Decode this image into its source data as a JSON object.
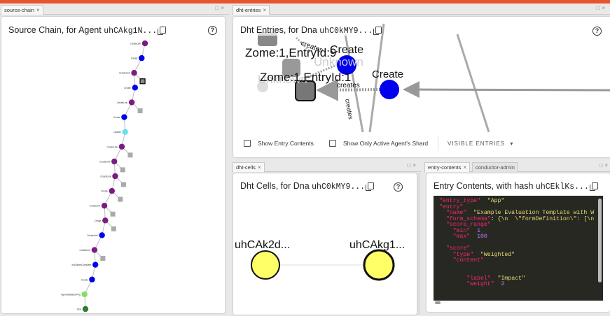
{
  "panels": {
    "source_chain": {
      "tab": "source-chain",
      "title_prefix": "Source Chain",
      "title_middle": ", for Agent ",
      "agent_hash": "uhCAkg1N...",
      "nodes": [
        {
          "label": "CreateLink",
          "color": "#7b1c82"
        },
        {
          "label": "Create",
          "color": "#0000ee"
        },
        {
          "label": "CreateLink",
          "color": "#7b1c82"
        },
        {
          "label": "Create",
          "color": "#0000ee"
        },
        {
          "label": "CreateLink",
          "color": "#7b1c82"
        },
        {
          "label": "Create",
          "color": "#0000ee"
        },
        {
          "label": "Update",
          "color": "#66e0ee"
        },
        {
          "label": "CreateLink",
          "color": "#7b1c82"
        },
        {
          "label": "CreateLink",
          "color": "#7b1c82"
        },
        {
          "label": "CreateLink",
          "color": "#7b1c82"
        },
        {
          "label": "Create",
          "color": "#7b1c82"
        },
        {
          "label": "CreateLink",
          "color": "#7b1c82"
        },
        {
          "label": "Create",
          "color": "#7b1c82"
        },
        {
          "label": "CreateLink",
          "color": "#0000ee"
        },
        {
          "label": "CreateLink",
          "color": "#7b1c82"
        },
        {
          "label": "InitZomesComplete",
          "color": "#0000ee"
        },
        {
          "label": "Create",
          "color": "#0000ee"
        },
        {
          "label": "AgentValidationPkg",
          "color": "#80e060"
        },
        {
          "label": "Dna",
          "color": "#2e7d32"
        }
      ]
    },
    "dht_entries": {
      "tab": "dht-entries",
      "title_prefix": "Dht Entries",
      "title_middle": ", for Dna ",
      "dna_hash": "uhC0kMY9...",
      "graph_labels": {
        "zome1": "Zome:1,EntryId:9",
        "zome2": "Zome:1,EntryId:1",
        "create1": "Create",
        "create2": "Create",
        "unknown1": "Unknown",
        "unknown2": "Unknown",
        "creates1": "creates",
        "creates2": "creates",
        "creates3": "creates"
      },
      "show_entry_contents": "Show Entry Contents",
      "show_active_shard": "Show Only Active Agent's Shard",
      "visible_entries": "VISIBLE ENTRIES"
    },
    "dht_cells": {
      "tab": "dht-cells",
      "title_prefix": "Dht Cells",
      "title_middle": ", for Dna ",
      "dna_hash": "uhC0kMY9...",
      "cell_a": "uhCAk2d...",
      "cell_b": "uhCAkg1..."
    },
    "entry_contents": {
      "tab": "entry-contents",
      "tab2": "conductor-admin",
      "title_prefix": "Entry Contents",
      "title_middle": ", with hash ",
      "entry_hash": "uhCEklKs...",
      "code": {
        "entry_type_key": "\"entry_type\"",
        "entry_type_val": "\"App\"",
        "entry_key": "\"entry\"",
        "name_key": "\"name\"",
        "name_val": "\"Example Evaluation Template with W",
        "form_schema_key": "\"form_schema\"",
        "form_schema_val": "{\\n  \\\"formDefinition\\\": [\\n",
        "score_range_key": "\"score_range\"",
        "min_key": "\"min\"",
        "min_val": "1",
        "max_key": "\"max\"",
        "max_val": "100",
        "score_key": "\"score\"",
        "type_key": "\"type\"",
        "type_val": "\"Weighted\"",
        "content_key": "\"content\"",
        "label_key": "\"label\"",
        "label_val": "\"Impact\"",
        "weight_key": "\"weight\"",
        "weight_val": "2"
      }
    }
  },
  "colors": {
    "accent_bar": "#e8552d",
    "create_blue": "#0000ee",
    "link_purple": "#7b1c82",
    "cell_yellow": "#ffff66"
  },
  "icons": {
    "help": "help-icon",
    "copy": "copy-icon",
    "close": "close-icon",
    "maximize": "maximize-icon",
    "dropdown": "caret-down-icon"
  },
  "help_glyph": "?",
  "close_glyph": "×",
  "maximize_glyph": "□",
  "caret_glyph": "▾"
}
